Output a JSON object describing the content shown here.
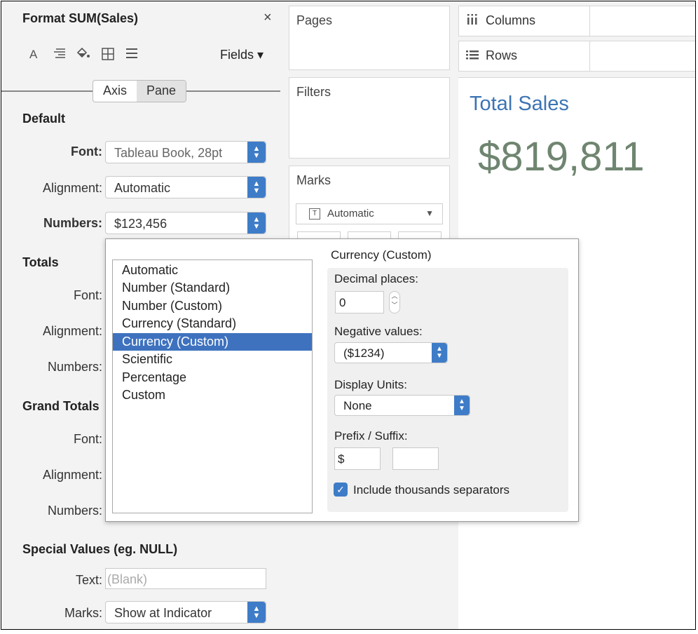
{
  "format_pane": {
    "title": "Format SUM(Sales)",
    "close_glyph": "×",
    "toolbar": {
      "icons": [
        "font-icon",
        "align-icon",
        "shading-icon",
        "borders-icon",
        "lines-icon"
      ],
      "fields_label": "Fields ▾"
    },
    "tabs": [
      {
        "label": "Axis",
        "active": false
      },
      {
        "label": "Pane",
        "active": true
      }
    ],
    "default": {
      "heading": "Default",
      "font_label": "Font:",
      "font_value": "Tableau Book, 28pt",
      "alignment_label": "Alignment:",
      "alignment_value": "Automatic",
      "numbers_label": "Numbers:",
      "numbers_value": "$123,456"
    },
    "totals": {
      "heading": "Totals",
      "font_label": "Font:",
      "alignment_label": "Alignment:",
      "numbers_label": "Numbers:"
    },
    "grand_totals": {
      "heading": "Grand Totals",
      "font_label": "Font:",
      "alignment_label": "Alignment:",
      "numbers_label": "Numbers:"
    },
    "special_values": {
      "heading": "Special Values (eg. NULL)",
      "text_label": "Text:",
      "text_placeholder": "(Blank)",
      "marks_label": "Marks:",
      "marks_value": "Show at Indicator"
    }
  },
  "shelves": {
    "pages": "Pages",
    "filters": "Filters",
    "marks": "Marks",
    "marks_type": "Automatic",
    "columns": "Columns",
    "rows": "Rows"
  },
  "view": {
    "title": "Total Sales",
    "value": "$819,811"
  },
  "number_format_popup": {
    "list": [
      "Automatic",
      "Number (Standard)",
      "Number (Custom)",
      "Currency (Standard)",
      "Currency (Custom)",
      "Scientific",
      "Percentage",
      "Custom"
    ],
    "selected_index": 4,
    "detail_title": "Currency (Custom)",
    "decimal_places_label": "Decimal places:",
    "decimal_places_value": "0",
    "negative_values_label": "Negative values:",
    "negative_values_value": "($1234)",
    "display_units_label": "Display Units:",
    "display_units_value": "None",
    "prefix_suffix_label": "Prefix / Suffix:",
    "prefix_value": "$",
    "suffix_value": "",
    "thousands_label": "Include thousands separators",
    "thousands_checked": true
  },
  "colors": {
    "accent_blue": "#3e7cc8",
    "selection_blue": "#3e72bf",
    "title_blue": "#3c74b4",
    "value_green": "#6f8570"
  }
}
